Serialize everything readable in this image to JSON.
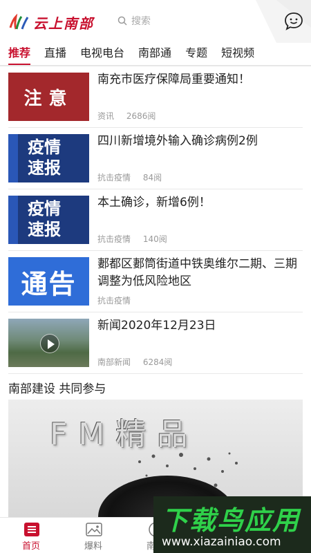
{
  "header": {
    "logo_text": "云上南部",
    "search_placeholder": "搜索"
  },
  "tabs": [
    {
      "label": "推荐",
      "active": true
    },
    {
      "label": "直播"
    },
    {
      "label": "电视电台"
    },
    {
      "label": "南部通"
    },
    {
      "label": "专题"
    },
    {
      "label": "短视频"
    }
  ],
  "news": [
    {
      "title": "南充市医疗保障局重要通知！",
      "category": "资讯",
      "reads": "2686阅",
      "thumb_text": "注意"
    },
    {
      "title": "四川新增境外输入确诊病例2例",
      "category": "抗击疫情",
      "reads": "84阅",
      "thumb_text": "疫情速报"
    },
    {
      "title": "本土确诊，新增6例！",
      "category": "抗击疫情",
      "reads": "140阅",
      "thumb_text": "疫情速报"
    },
    {
      "title": "郪都区郪筒街道中铁奥维尔二期、三期调整为低风险地区",
      "category": "抗击疫情",
      "reads": "",
      "thumb_text": "通告"
    },
    {
      "title": "新闻2020年12月23日",
      "category": "南部新闻",
      "reads": "6284阅",
      "thumb_text": ""
    }
  ],
  "section": {
    "title": "南部建设 共同参与",
    "banner_text": "FM精品"
  },
  "bottom_nav": [
    {
      "label": "首页",
      "active": true,
      "icon": "home-list-icon"
    },
    {
      "label": "爆料",
      "icon": "image-icon"
    },
    {
      "label": "南部",
      "icon": "compass-icon"
    }
  ],
  "watermark": {
    "title": "下载鸟应用",
    "url": "www.xiazainiao.com"
  },
  "colors": {
    "accent": "#c8102e",
    "watermark_green": "#2fd14a"
  }
}
